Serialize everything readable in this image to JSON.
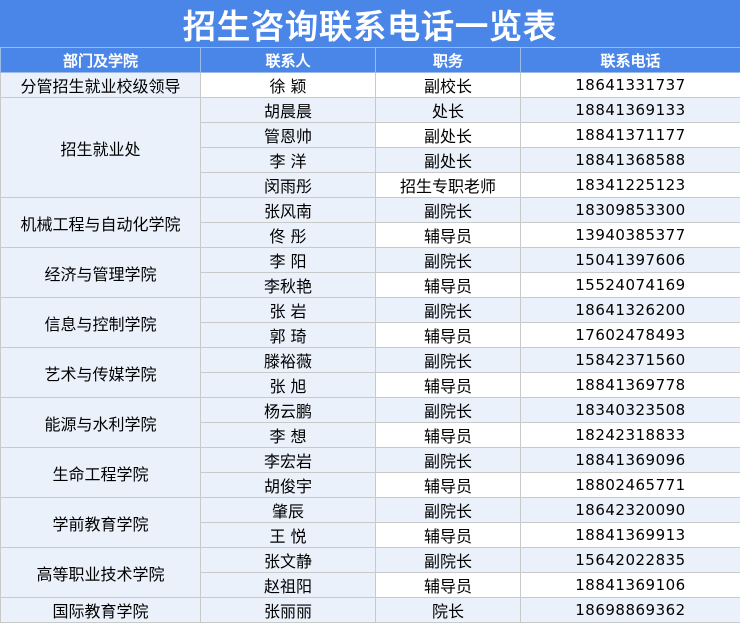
{
  "title": "招生咨询联系电话一览表",
  "headers": [
    "部门及学院",
    "联系人",
    "职务",
    "联系电话"
  ],
  "groups": [
    {
      "dept": "分管招生就业校级领导",
      "rows": [
        {
          "name": "徐  颖",
          "role": "副校长",
          "phone": "18641331737"
        }
      ]
    },
    {
      "dept": "招生就业处",
      "rows": [
        {
          "name": "胡晨晨",
          "role": "处长",
          "phone": "18841369133"
        },
        {
          "name": "管恩帅",
          "role": "副处长",
          "phone": "18841371177"
        },
        {
          "name": "李  洋",
          "role": "副处长",
          "phone": "18841368588"
        },
        {
          "name": "闵雨彤",
          "role": "招生专职老师",
          "phone": "18341225123"
        }
      ]
    },
    {
      "dept": "机械工程与自动化学院",
      "rows": [
        {
          "name": "张风南",
          "role": "副院长",
          "phone": "18309853300"
        },
        {
          "name": "佟  彤",
          "role": "辅导员",
          "phone": "13940385377"
        }
      ]
    },
    {
      "dept": "经济与管理学院",
      "rows": [
        {
          "name": "李    阳",
          "role": "副院长",
          "phone": "15041397606"
        },
        {
          "name": "李秋艳",
          "role": "辅导员",
          "phone": "15524074169"
        }
      ]
    },
    {
      "dept": "信息与控制学院",
      "rows": [
        {
          "name": "张  岩",
          "role": "副院长",
          "phone": "18641326200"
        },
        {
          "name": "郭  琦",
          "role": "辅导员",
          "phone": "17602478493"
        }
      ]
    },
    {
      "dept": "艺术与传媒学院",
      "rows": [
        {
          "name": "滕裕薇",
          "role": "副院长",
          "phone": "15842371560"
        },
        {
          "name": "张    旭",
          "role": "辅导员",
          "phone": "18841369778"
        }
      ]
    },
    {
      "dept": "能源与水利学院",
      "rows": [
        {
          "name": "杨云鹏",
          "role": "副院长",
          "phone": "18340323508"
        },
        {
          "name": "李  想",
          "role": "辅导员",
          "phone": "18242318833"
        }
      ]
    },
    {
      "dept": "生命工程学院",
      "rows": [
        {
          "name": "李宏岩",
          "role": "副院长",
          "phone": "18841369096"
        },
        {
          "name": "胡俊宇",
          "role": "辅导员",
          "phone": "18802465771"
        }
      ]
    },
    {
      "dept": "学前教育学院",
      "rows": [
        {
          "name": "肇辰",
          "role": "副院长",
          "phone": "18642320090"
        },
        {
          "name": "王  悦",
          "role": "辅导员",
          "phone": "18841369913"
        }
      ]
    },
    {
      "dept": "高等职业技术学院",
      "rows": [
        {
          "name": "张文静",
          "role": "副院长",
          "phone": "15642022835"
        },
        {
          "name": "赵祖阳",
          "role": "辅导员",
          "phone": "18841369106"
        }
      ]
    },
    {
      "dept": "国际教育学院",
      "rows": [
        {
          "name": "张丽丽",
          "role": "院长",
          "phone": "18698869362"
        }
      ]
    }
  ]
}
